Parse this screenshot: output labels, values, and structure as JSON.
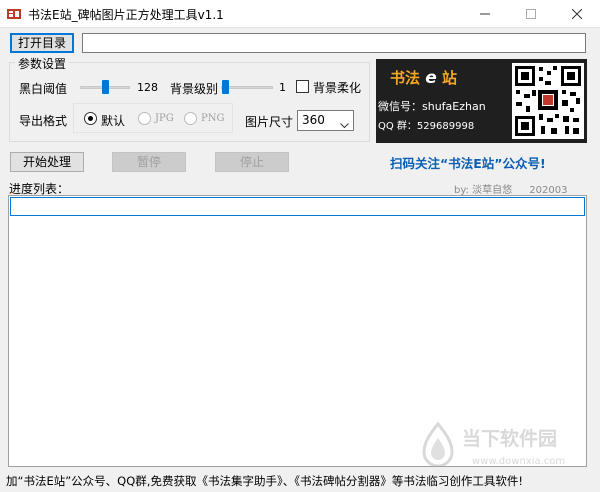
{
  "window": {
    "title": "书法E站_碑帖图片正方处理工具v1.1"
  },
  "toolbar": {
    "open_dir_label": "打开目录",
    "path_value": ""
  },
  "params": {
    "group_title": "参数设置",
    "threshold": {
      "label": "黑白阈值",
      "value": "128",
      "level": 0.5
    },
    "bg_level": {
      "label": "背景级别",
      "value": "1",
      "level": 0.02
    },
    "bg_soften": {
      "label": "背景柔化",
      "checked": false
    },
    "export_format": {
      "label": "导出格式",
      "options": [
        {
          "label": "默认",
          "checked": true,
          "disabled": false
        },
        {
          "label": "JPG",
          "checked": false,
          "disabled": true
        },
        {
          "label": "PNG",
          "checked": false,
          "disabled": true
        }
      ]
    },
    "image_size": {
      "label": "图片尺寸",
      "value": "360"
    }
  },
  "banner": {
    "brand_left": "书法",
    "brand_e": "e",
    "brand_right": "站",
    "wechat": "微信号：shufaEzhan",
    "qq": "QQ 群：529689998"
  },
  "actions": {
    "start_label": "开始处理",
    "pause_label": "暂停",
    "stop_label": "停止"
  },
  "promo_text": "扫码关注“书法E站”公众号!",
  "progress": {
    "label": "进度列表：",
    "author": "by: 淡草自悠",
    "date": "202003"
  },
  "status_text": "加“书法E站”公众号、QQ群,免费获取《书法集字助手》、《书法碑帖分割器》等书法临习创作工具软件!",
  "watermark": {
    "title": "当下软件园",
    "url": "www.downxia.com"
  },
  "icons": {
    "app": "seal-icon",
    "minimize": "minimize-icon",
    "maximize": "maximize-icon",
    "close": "close-icon",
    "dropdown": "chevron-down-icon",
    "qr": "qr-code-icon",
    "watermark_logo": "downxia-logo-icon"
  },
  "colors": {
    "accent": "#0078d7",
    "promo": "#0a5fb4",
    "banner_bg": "#1f1f1f",
    "brand": "#f5a623"
  }
}
